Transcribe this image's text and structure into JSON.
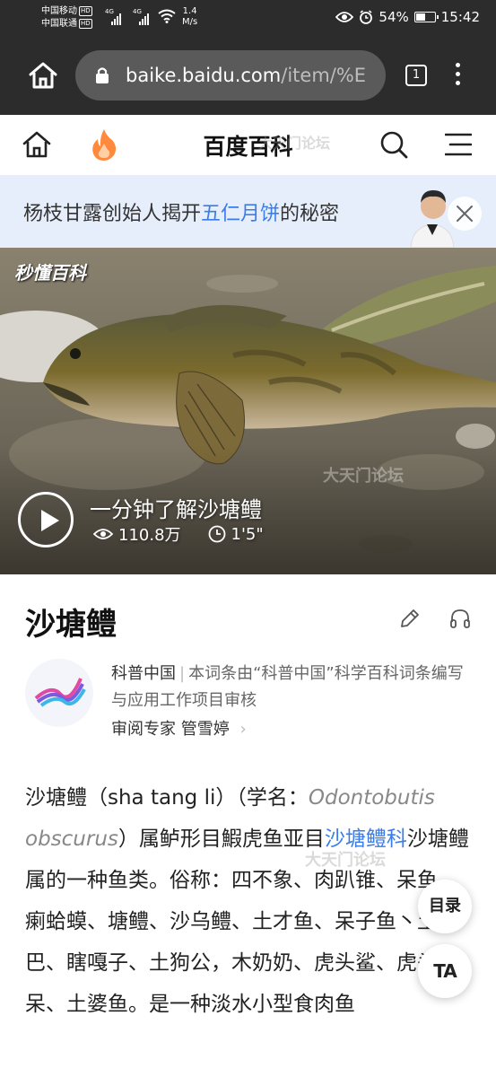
{
  "status_bar": {
    "carrier_1": "中国移动",
    "carrier_2": "中国联通",
    "hd_badge": "HD",
    "net_label_1": "4G",
    "net_label_2": "4G",
    "speed_value": "1.4",
    "speed_unit": "M/s",
    "battery_text": "54%",
    "battery_level": 0.54,
    "time": "15:42"
  },
  "browser": {
    "url_main": "baike.baidu.com",
    "url_path": "/item/%E",
    "tab_count": "1"
  },
  "site_header": {
    "title": "百度百科",
    "watermark": "大天门论坛"
  },
  "promo": {
    "text_before": "杨枝甘露创始人揭开",
    "text_highlight": "五仁月饼",
    "text_after": "的秘密"
  },
  "video": {
    "logo": "秒懂百科",
    "title": "一分钟了解沙塘鳢",
    "views": "110.8万",
    "duration": "1'5\"",
    "watermark": "大天门论坛"
  },
  "article": {
    "title": "沙塘鳢",
    "source_name": "科普中国",
    "source_desc": "本词条由“科普中国”科学百科词条编写与应用工作项目审核",
    "expert_label": "审阅专家",
    "expert_name": "管雪婷",
    "para_part1": "沙塘鳢（sha tang li）（学名：",
    "para_latin": "Odontobutis obscurus",
    "para_part2": "）属鲈形目鰕虎鱼亚目",
    "para_link": "沙塘鳢科",
    "para_part3": "沙塘鳢属的一种鱼类。俗称：四不象、肉趴锥、呆鱼、瘌蛤蟆、塘鳢、沙乌鳢、土才鱼、呆子鱼丶土鲋巴、瞎嘎子、土狗公，木奶奶、虎头鲨、虎头呆、土婆鱼。是一种淡水小型食肉鱼",
    "watermark": "大天门论坛"
  },
  "floating": {
    "toc_label": "目录",
    "ta_label": "TA"
  },
  "colors": {
    "accent_blue": "#3b7de8",
    "promo_bg": "#e6eefb",
    "chrome_dark": "#2c2c2c"
  }
}
